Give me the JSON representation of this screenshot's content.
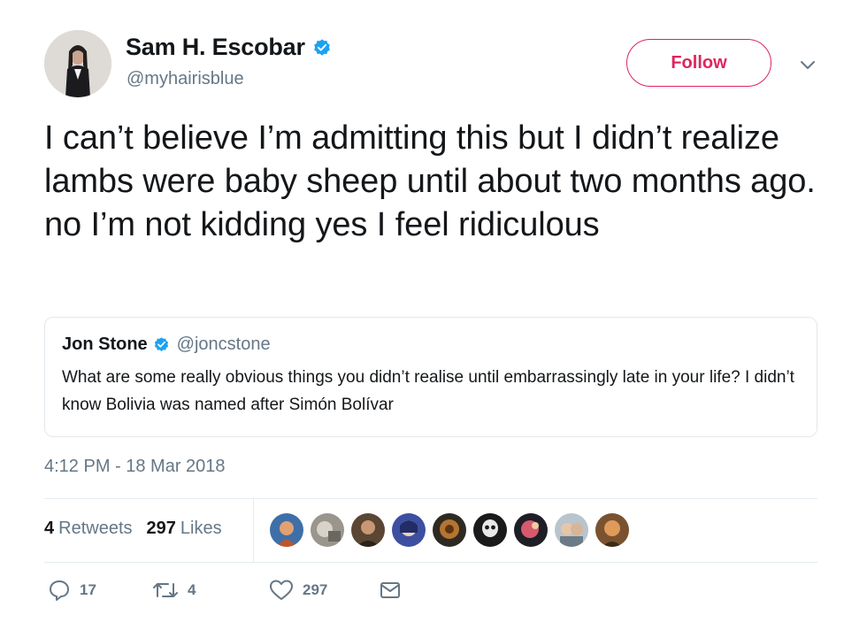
{
  "author": {
    "name": "Sam H. Escobar",
    "handle": "@myhairisblue",
    "avatar_icon": "profile-photo-avatar"
  },
  "follow_button": {
    "label": "Follow",
    "color": "#e0245e"
  },
  "menu_icon": "chevron-down-icon",
  "tweet": {
    "text": "I can’t believe I’m admitting this but I didn’t realize lambs were baby sheep until about two months ago. no I’m not kidding yes I feel ridiculous",
    "timestamp": "4:12 PM - 18 Mar 2018"
  },
  "quoted_tweet": {
    "name": "Jon Stone",
    "handle": "@joncstone",
    "text": "What are some really obvious things you didn’t realise until embarrassingly late in your life? I didn’t know Bolivia was named after Simón Bolívar"
  },
  "stats": {
    "retweets_count": "4",
    "retweets_label": "Retweets",
    "likes_count": "297",
    "likes_label": "Likes"
  },
  "likers_count": 9,
  "actions": {
    "reply_count": "17",
    "retweet_count": "4",
    "like_count": "297"
  },
  "colors": {
    "verified": "#1da1f2",
    "secondary_text": "#657786",
    "accent_follow": "#e0245e"
  }
}
